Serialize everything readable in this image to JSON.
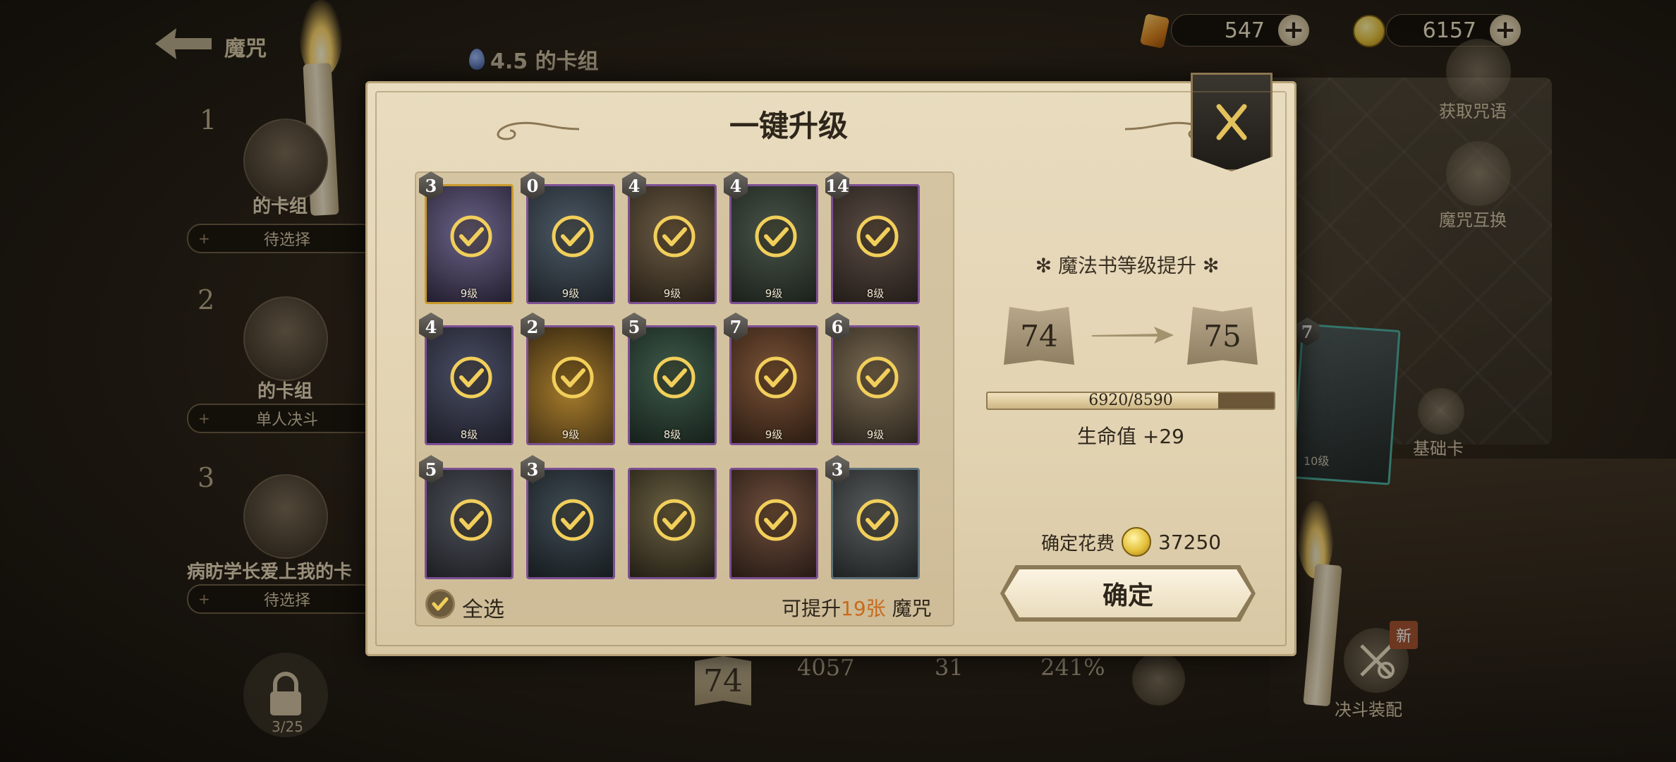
{
  "header": {
    "title": "魔咒",
    "deck_title": "4.5 的卡组"
  },
  "currency": {
    "gems": "547",
    "coins": "6157"
  },
  "decks": [
    {
      "index": "1",
      "name": "的卡组",
      "status": "待选择"
    },
    {
      "index": "2",
      "name": "的卡组",
      "status": "单人决斗"
    },
    {
      "index": "3",
      "name": "病眆学长爱上我的卡",
      "status": "待选择"
    }
  ],
  "locked_slots": "3/25",
  "side_menu": {
    "get_spells": "获取咒语",
    "swap_spells": "魔咒互换",
    "basic_card": "基础卡",
    "duel_setup": "决斗装配",
    "new_tag": "新"
  },
  "bottom_stats": {
    "level": "74",
    "hp": "4057",
    "power": "31",
    "percent": "241%"
  },
  "peek_card": {
    "badge": "7",
    "level": "10级"
  },
  "modal": {
    "title": "一键升级",
    "cards": [
      {
        "badge": "3",
        "level": "9级"
      },
      {
        "badge": "0",
        "level": "9级"
      },
      {
        "badge": "4",
        "level": "9级"
      },
      {
        "badge": "4",
        "level": "9级"
      },
      {
        "badge": "14",
        "level": "8级"
      },
      {
        "badge": "4",
        "level": "8级"
      },
      {
        "badge": "2",
        "level": "9级"
      },
      {
        "badge": "5",
        "level": "8级"
      },
      {
        "badge": "7",
        "level": "9级"
      },
      {
        "badge": "6",
        "level": "9级"
      },
      {
        "badge": "5",
        "level": ""
      },
      {
        "badge": "3",
        "level": ""
      },
      {
        "badge": "",
        "level": ""
      },
      {
        "badge": "",
        "level": ""
      },
      {
        "badge": "3",
        "level": ""
      }
    ],
    "select_all_label": "全选",
    "upgrade_prefix": "可提升",
    "upgrade_count": "19张",
    "upgrade_suffix": "魔咒",
    "section_title": "魔法书等级提升",
    "level_from": "74",
    "level_to": "75",
    "progress_text": "6920/8590",
    "progress_fraction": 0.806,
    "hp_bonus": "生命值 +29",
    "cost_label": "确定花费",
    "cost_value": "37250",
    "confirm_label": "确定"
  },
  "colors": {
    "accent_orange": "#c76a1c",
    "card_border_purple": "#7d4f94",
    "check_gold": "#f2cf5b"
  }
}
